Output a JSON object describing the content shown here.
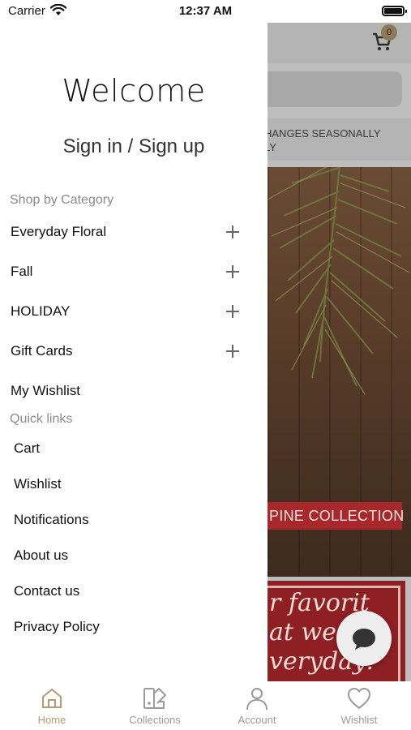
{
  "status_bar": {
    "carrier": "Carrier",
    "time": "12:37 AM"
  },
  "background_app": {
    "cart_badge": "0",
    "announcement_lines": [
      "HANGES SEASONALLY",
      "LY"
    ],
    "hero_banner": "PINE COLLECTION",
    "promo_lines": [
      "r favorit",
      "at we u",
      "veryday!"
    ]
  },
  "drawer": {
    "welcome_title": "Welcome",
    "signin_label": "Sign in / Sign up",
    "shop_by_category_label": "Shop by Category",
    "categories": [
      {
        "label": "Everyday Floral"
      },
      {
        "label": "Fall"
      },
      {
        "label": "HOLIDAY"
      },
      {
        "label": "Gift Cards"
      }
    ],
    "wishlist_link": "My Wishlist",
    "quick_links_label": "Quick links",
    "quick_links": [
      {
        "label": "Cart"
      },
      {
        "label": "Wishlist"
      },
      {
        "label": "Notifications"
      },
      {
        "label": "About us"
      },
      {
        "label": "Contact us"
      },
      {
        "label": "Privacy Policy"
      }
    ]
  },
  "tab_bar": {
    "tabs": [
      {
        "label": "Home",
        "icon": "home-icon",
        "active": true
      },
      {
        "label": "Collections",
        "icon": "collections-icon",
        "active": false
      },
      {
        "label": "Account",
        "icon": "account-icon",
        "active": false
      },
      {
        "label": "Wishlist",
        "icon": "heart-icon",
        "active": false
      }
    ]
  },
  "colors": {
    "accent": "#b39b6e",
    "badge": "#8e7a56",
    "banner_red": "#a8272a",
    "inactive_tab": "#9a9a9a"
  }
}
